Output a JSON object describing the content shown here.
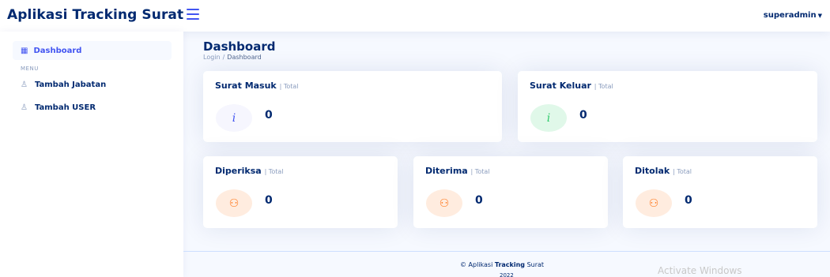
{
  "header": {
    "brand": "Aplikasi Tracking Surat",
    "user": "superadmin"
  },
  "sidebar": {
    "active_item": "Dashboard",
    "heading": "MENU",
    "items": [
      {
        "label": "Tambah Jabatan"
      },
      {
        "label": "Tambah USER"
      }
    ]
  },
  "page": {
    "title": "Dashboard",
    "breadcrumb": [
      "Login",
      "Dashboard"
    ]
  },
  "cards": [
    {
      "title": "Surat Masuk",
      "sub": "| Total",
      "value": "0",
      "icon": "info-icon",
      "glyph": "i"
    },
    {
      "title": "Surat Keluar",
      "sub": "| Total",
      "value": "0",
      "icon": "info-icon",
      "glyph": "i"
    },
    {
      "title": "Diperiksa",
      "sub": "| Total",
      "value": "0",
      "icon": "people-icon",
      "glyph": "⚇"
    },
    {
      "title": "Diterima",
      "sub": "| Total",
      "value": "0",
      "icon": "people-icon",
      "glyph": "⚇"
    },
    {
      "title": "Ditolak",
      "sub": "| Total",
      "value": "0",
      "icon": "people-icon",
      "glyph": "⚇"
    }
  ],
  "footer": {
    "copyright": "© Aplikasi",
    "bold": "Tracking",
    "rest": "Surat",
    "year": "2022"
  },
  "watermark": "Activate Windows",
  "colors": {
    "primary": "#4154f1",
    "text": "#012970",
    "muted": "#899bbd",
    "background": "#f6f9ff",
    "green": "#2eca6a",
    "orange": "#ff771d"
  }
}
